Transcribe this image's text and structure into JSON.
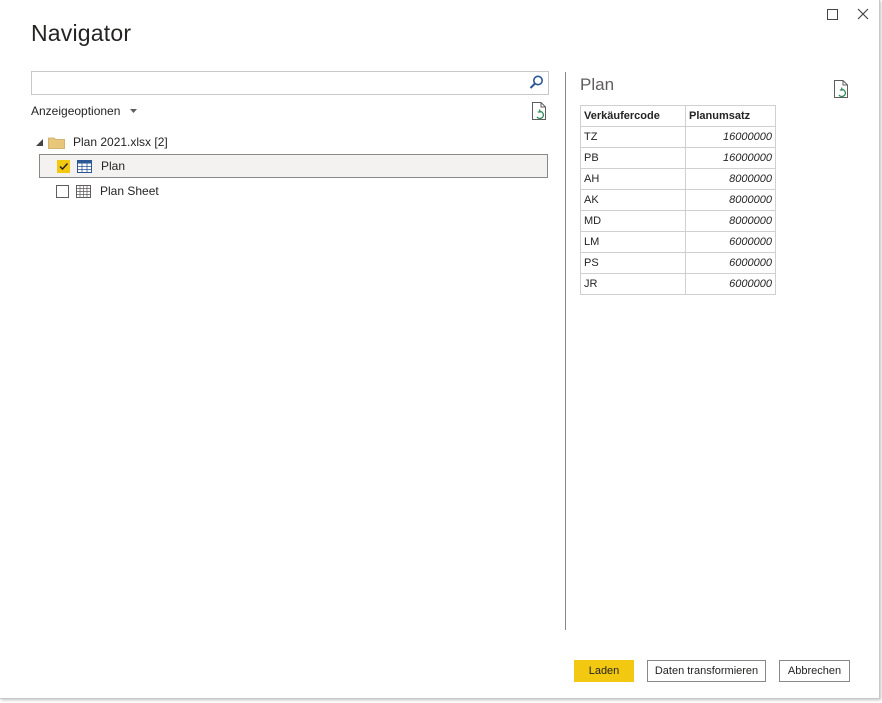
{
  "window": {
    "title": "Navigator",
    "maximize_icon": "maximize-icon",
    "close_icon": "close-icon"
  },
  "search": {
    "value": "",
    "placeholder": "",
    "icon": "search-icon"
  },
  "display_options": {
    "label": "Anzeigeoptionen",
    "icon": "caret-down-icon"
  },
  "tree": {
    "file": {
      "label": "Plan 2021.xlsx [2]",
      "expanded": true,
      "icon": "folder-icon"
    },
    "items": [
      {
        "label": "Plan",
        "checked": true,
        "selected": true,
        "icon": "table-icon"
      },
      {
        "label": "Plan Sheet",
        "checked": false,
        "selected": false,
        "icon": "sheet-icon"
      }
    ]
  },
  "preview": {
    "title": "Plan",
    "columns": [
      "Verkäufercode",
      "Planumsatz"
    ],
    "rows": [
      [
        "TZ",
        "16000000"
      ],
      [
        "PB",
        "16000000"
      ],
      [
        "AH",
        "8000000"
      ],
      [
        "AK",
        "8000000"
      ],
      [
        "MD",
        "8000000"
      ],
      [
        "LM",
        "6000000"
      ],
      [
        "PS",
        "6000000"
      ],
      [
        "JR",
        "6000000"
      ]
    ]
  },
  "footer": {
    "load_label": "Laden",
    "transform_label": "Daten transformieren",
    "cancel_label": "Abbrechen"
  },
  "colors": {
    "accent": "#f2c811",
    "border": "#8a8886",
    "text": "#252423"
  }
}
